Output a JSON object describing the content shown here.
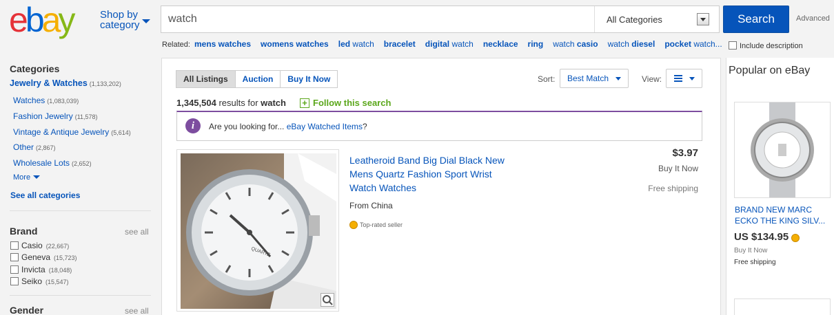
{
  "header": {
    "logo": {
      "e": "e",
      "b": "b",
      "a": "a",
      "y": "y"
    },
    "shop_by": "Shop by\ncategory",
    "search_value": "watch",
    "category_select": "All Categories",
    "search_button": "Search",
    "advanced": "Advanced",
    "related_label": "Related:",
    "related": [
      {
        "bold": "mens watches",
        "rest": ""
      },
      {
        "bold": "womens watches",
        "rest": ""
      },
      {
        "bold": "led",
        "rest": " watch"
      },
      {
        "bold": "bracelet",
        "rest": ""
      },
      {
        "bold": "digital",
        "rest": " watch"
      },
      {
        "bold": "necklace",
        "rest": ""
      },
      {
        "bold": "ring",
        "rest": ""
      },
      {
        "bold": "",
        "rest": "watch ",
        "bold2": "casio"
      },
      {
        "bold": "",
        "rest": "watch ",
        "bold2": "diesel"
      },
      {
        "bold": "pocket",
        "rest": " watch..."
      }
    ],
    "include_description": "Include description"
  },
  "sidebar": {
    "categories_title": "Categories",
    "top_category": {
      "label": "Jewelry & Watches",
      "count": "(1,133,202)"
    },
    "subcategories": [
      {
        "label": "Watches",
        "count": "(1,083,039)"
      },
      {
        "label": "Fashion Jewelry",
        "count": "(11,578)"
      },
      {
        "label": "Vintage & Antique Jewelry",
        "count": "(5,614)"
      },
      {
        "label": "Other",
        "count": "(2,867)"
      },
      {
        "label": "Wholesale Lots",
        "count": "(2,652)"
      }
    ],
    "more": "More",
    "see_all_categories": "See all categories",
    "brand_title": "Brand",
    "see_all": "see all",
    "brands": [
      {
        "label": "Casio",
        "count": "(22,667)"
      },
      {
        "label": "Geneva",
        "count": "(15,723)"
      },
      {
        "label": "Invicta",
        "count": "(18,048)"
      },
      {
        "label": "Seiko",
        "count": "(15,547)"
      }
    ],
    "gender_title": "Gender",
    "gender_see_all": "see all"
  },
  "main": {
    "tabs": [
      "All Listings",
      "Auction",
      "Buy It Now"
    ],
    "sort_label": "Sort:",
    "sort_value": "Best Match",
    "view_label": "View:",
    "result_count": "1,345,504",
    "results_for": " results for ",
    "query": "watch",
    "follow": "Follow this search",
    "suggest_prefix": "Are you looking for... ",
    "suggest_link": "eBay Watched Items",
    "suggest_suffix": "?",
    "item": {
      "title": "Leatheroid Band Big Dial Black New Mens Quartz Fashion Sport Wrist Watch Watches",
      "from": "From China",
      "seller_badge": "Top-rated seller",
      "price": "$3.97",
      "format": "Buy It Now",
      "shipping": "Free shipping",
      "dial_text": "QUARTZ"
    }
  },
  "popular": {
    "title": "Popular on eBay",
    "item_title": "BRAND NEW MARC ECKO THE KING SILV...",
    "price": "US $134.95",
    "format": "Buy It Now",
    "shipping": "Free shipping"
  },
  "colors": {
    "ebay_red": "#e53238",
    "ebay_blue": "#0064d2",
    "ebay_yellow": "#f5af02",
    "ebay_green": "#86b817",
    "link": "#0654ba",
    "info_purple": "#7d4d9f"
  }
}
